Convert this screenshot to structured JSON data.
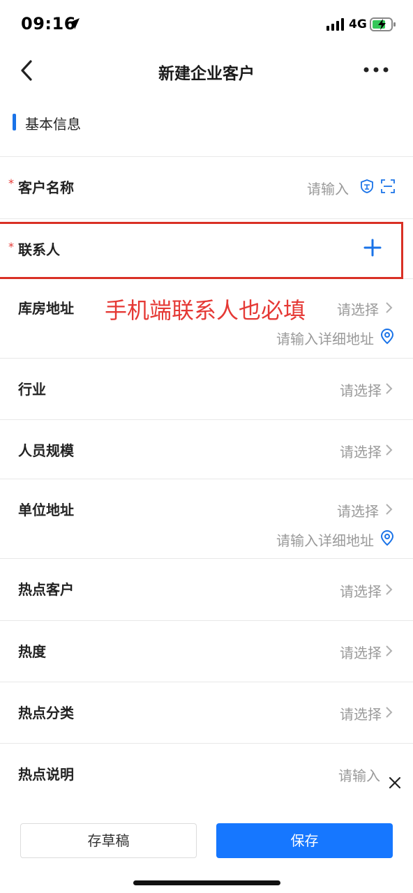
{
  "status": {
    "time": "09:16",
    "network": "4G"
  },
  "nav": {
    "title": "新建企业客户"
  },
  "section": {
    "title": "基本信息"
  },
  "fields": {
    "customer_name": {
      "label": "客户名称",
      "placeholder": "请输入",
      "required_mark": "*"
    },
    "contact": {
      "label": "联系人",
      "required_mark": "*"
    },
    "warehouse_address": {
      "label": "库房地址",
      "value": "请选择",
      "detail": "请输入详细地址"
    },
    "industry": {
      "label": "行业",
      "value": "请选择"
    },
    "staff_size": {
      "label": "人员规模",
      "value": "请选择"
    },
    "unit_address": {
      "label": "单位地址",
      "value": "请选择",
      "detail": "请输入详细地址"
    },
    "hot_customer": {
      "label": "热点客户",
      "value": "请选择"
    },
    "heat": {
      "label": "热度",
      "value": "请选择"
    },
    "hot_category": {
      "label": "热点分类",
      "value": "请选择"
    },
    "hot_description": {
      "label": "热点说明",
      "placeholder": "请输入"
    }
  },
  "annotation": {
    "text": "手机端联系人也必填"
  },
  "actions": {
    "draft_label": "存草稿",
    "save_label": "保存"
  },
  "colors": {
    "accent": "#1677ff",
    "required": "#e53935",
    "annotation": "#d93025"
  },
  "icons": [
    "location-arrow-icon",
    "signal-icon",
    "battery-charging-icon",
    "back-icon",
    "more-icon",
    "shield-icon",
    "scan-icon",
    "plus-icon",
    "chevron-right-icon",
    "location-pin-icon",
    "close-icon"
  ]
}
